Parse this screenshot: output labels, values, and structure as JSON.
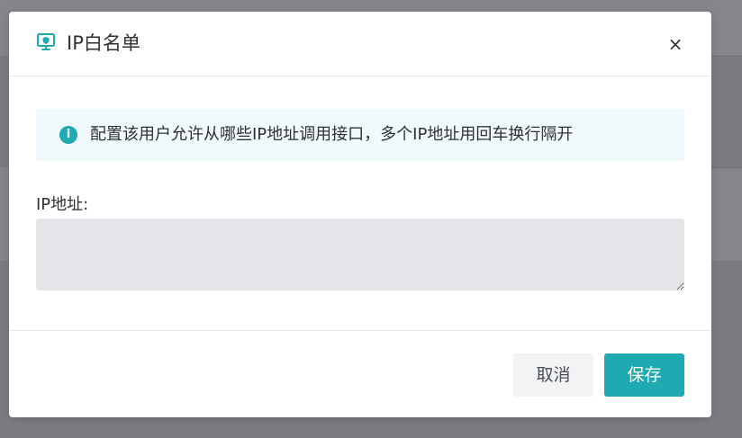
{
  "dialog": {
    "title": "IP白名单",
    "header_icon": "monitor-shield-icon",
    "close_label": "×",
    "info": {
      "icon": "info-icon",
      "icon_glyph": "i",
      "text": "配置该用户允许从哪些IP地址调用接口，多个IP地址用回车换行隔开"
    },
    "ip_field": {
      "label": "IP地址:",
      "value": "",
      "placeholder": ""
    },
    "buttons": {
      "cancel_label": "取消",
      "save_label": "保存"
    }
  },
  "colors": {
    "accent": "#1fa9b0",
    "info_background": "#f0f9fb",
    "overlay": "#7a7c80",
    "textarea_background": "#e4e5e8"
  }
}
